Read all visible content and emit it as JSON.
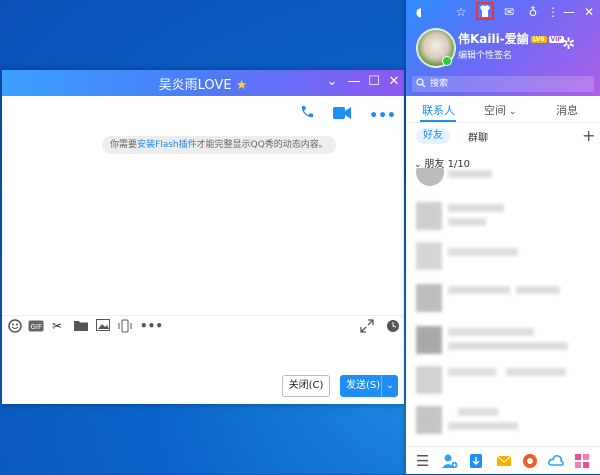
{
  "chat": {
    "title": "吴炎雨LOVE",
    "flash_notice_prefix": "你需要",
    "flash_notice_link": "安装Flash插件",
    "flash_notice_suffix": "才能完整显示QQ秀的动态内容。",
    "close_label": "关闭(C)",
    "send_label": "发送(S)"
  },
  "qq": {
    "nickname": "伟Kaili-爱諭",
    "lv_badge": "LV6",
    "vip_badge": "VIP",
    "signature": "编辑个性签名",
    "search_placeholder": "搜索",
    "tabs": [
      "联系人",
      "空间",
      "消息"
    ],
    "subtabs": [
      "好友",
      "群聊"
    ],
    "group_header": "朋友 1/10"
  },
  "colors": {
    "accent": "#1e8ef5",
    "title_gradient_start": "#3aa1ff",
    "title_gradient_end": "#8e58f0"
  }
}
